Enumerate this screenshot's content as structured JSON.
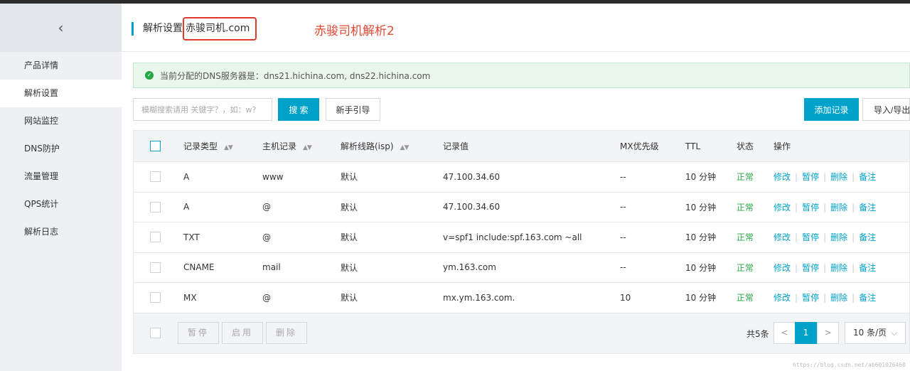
{
  "sidebar": {
    "back_icon": "‹",
    "items": [
      {
        "label": "产品详情"
      },
      {
        "label": "解析设置",
        "active": true
      },
      {
        "label": "网站监控"
      },
      {
        "label": "DNS防护"
      },
      {
        "label": "流量管理"
      },
      {
        "label": "QPS统计"
      },
      {
        "label": "解析日志"
      }
    ]
  },
  "header": {
    "title": "解析设置",
    "domain": "赤骏司机.com",
    "annotation": "赤骏司机解析2"
  },
  "notice": {
    "text": "当前分配的DNS服务器是：dns21.hichina.com, dns22.hichina.com"
  },
  "toolbar": {
    "search_placeholder": "模糊搜索请用 关键字？，如：w?",
    "search_label": "搜 索",
    "guide_label": "新手引导",
    "add_label": "添加记录",
    "import_label": "导入/导出"
  },
  "table": {
    "headers": [
      "记录类型",
      "主机记录",
      "解析线路(isp)",
      "记录值",
      "MX优先级",
      "TTL",
      "状态",
      "操作"
    ],
    "rows": [
      {
        "type": "A",
        "host": "www",
        "line": "默认",
        "value": "47.100.34.60",
        "mx": "--",
        "ttl": "10 分钟",
        "status": "正常"
      },
      {
        "type": "A",
        "host": "@",
        "line": "默认",
        "value": "47.100.34.60",
        "mx": "--",
        "ttl": "10 分钟",
        "status": "正常"
      },
      {
        "type": "TXT",
        "host": "@",
        "line": "默认",
        "value": "v=spf1 include:spf.163.com ~all",
        "mx": "--",
        "ttl": "10 分钟",
        "status": "正常"
      },
      {
        "type": "CNAME",
        "host": "mail",
        "line": "默认",
        "value": "ym.163.com",
        "mx": "--",
        "ttl": "10 分钟",
        "status": "正常"
      },
      {
        "type": "MX",
        "host": "@",
        "line": "默认",
        "value": "mx.ym.163.com.",
        "mx": "10",
        "ttl": "10 分钟",
        "status": "正常"
      }
    ],
    "actions": [
      "修改",
      "暂停",
      "删除",
      "备注"
    ]
  },
  "footer": {
    "pause_label": "暂停",
    "enable_label": "启用",
    "delete_label": "删除",
    "total": "共5条",
    "prev_icon": "<",
    "page": "1",
    "next_icon": ">",
    "page_size": "10 条/页"
  },
  "watermark": "https://blog.csdn.net/ab601026460"
}
